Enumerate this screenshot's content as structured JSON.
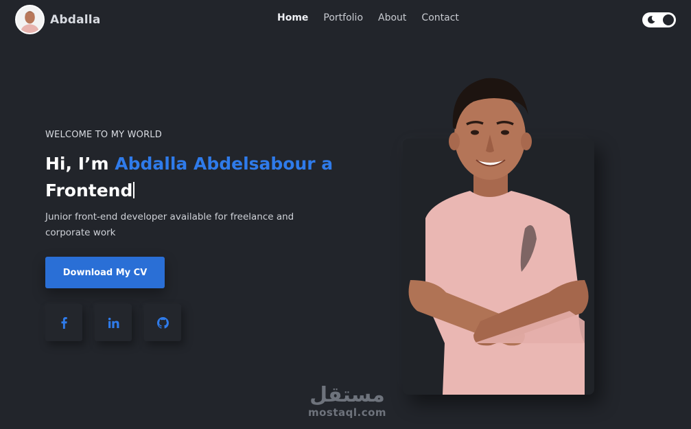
{
  "nav": {
    "brand": "Abdalla",
    "links": [
      {
        "label": "Home",
        "active": true
      },
      {
        "label": "Portfolio",
        "active": false
      },
      {
        "label": "About",
        "active": false
      },
      {
        "label": "Contact",
        "active": false
      }
    ],
    "theme_toggle": {
      "icon": "moon-icon",
      "state": "dark"
    }
  },
  "hero": {
    "welcome": "WELCOME TO MY WORLD",
    "greeting": "Hi, I’m",
    "name": "Abdalla Abdelsabour a",
    "typed_role": "Frontend",
    "description": "Junior front-end developer available for freelance and corporate work",
    "cv_button": "Download My CV"
  },
  "socials": [
    {
      "name": "facebook-icon",
      "glyph": "f"
    },
    {
      "name": "linkedin-icon",
      "glyph": "in"
    },
    {
      "name": "github-icon",
      "glyph": "gh"
    }
  ],
  "watermark": {
    "arabic": "مستقل",
    "latin": "mostaql.com"
  },
  "colors": {
    "background": "#22252b",
    "accent": "#2f7bea",
    "button": "#2a6fd6",
    "shirt": "#eab7b3"
  }
}
